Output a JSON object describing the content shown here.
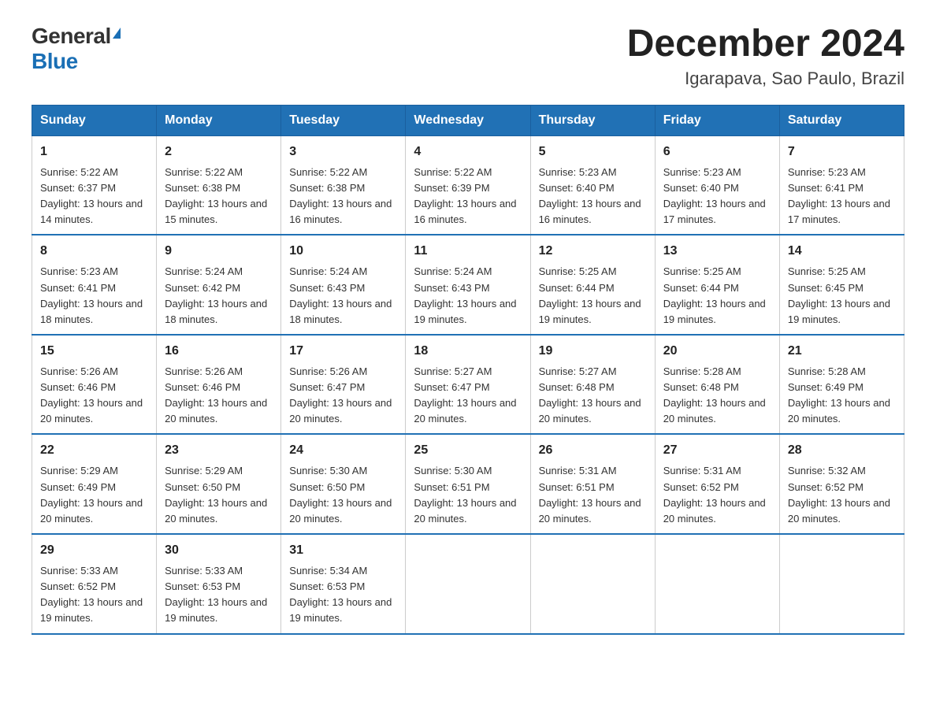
{
  "logo": {
    "general": "General",
    "blue": "Blue"
  },
  "title": "December 2024",
  "subtitle": "Igarapava, Sao Paulo, Brazil",
  "days_of_week": [
    "Sunday",
    "Monday",
    "Tuesday",
    "Wednesday",
    "Thursday",
    "Friday",
    "Saturday"
  ],
  "weeks": [
    [
      {
        "day": "1",
        "sunrise": "5:22 AM",
        "sunset": "6:37 PM",
        "daylight": "13 hours and 14 minutes."
      },
      {
        "day": "2",
        "sunrise": "5:22 AM",
        "sunset": "6:38 PM",
        "daylight": "13 hours and 15 minutes."
      },
      {
        "day": "3",
        "sunrise": "5:22 AM",
        "sunset": "6:38 PM",
        "daylight": "13 hours and 16 minutes."
      },
      {
        "day": "4",
        "sunrise": "5:22 AM",
        "sunset": "6:39 PM",
        "daylight": "13 hours and 16 minutes."
      },
      {
        "day": "5",
        "sunrise": "5:23 AM",
        "sunset": "6:40 PM",
        "daylight": "13 hours and 16 minutes."
      },
      {
        "day": "6",
        "sunrise": "5:23 AM",
        "sunset": "6:40 PM",
        "daylight": "13 hours and 17 minutes."
      },
      {
        "day": "7",
        "sunrise": "5:23 AM",
        "sunset": "6:41 PM",
        "daylight": "13 hours and 17 minutes."
      }
    ],
    [
      {
        "day": "8",
        "sunrise": "5:23 AM",
        "sunset": "6:41 PM",
        "daylight": "13 hours and 18 minutes."
      },
      {
        "day": "9",
        "sunrise": "5:24 AM",
        "sunset": "6:42 PM",
        "daylight": "13 hours and 18 minutes."
      },
      {
        "day": "10",
        "sunrise": "5:24 AM",
        "sunset": "6:43 PM",
        "daylight": "13 hours and 18 minutes."
      },
      {
        "day": "11",
        "sunrise": "5:24 AM",
        "sunset": "6:43 PM",
        "daylight": "13 hours and 19 minutes."
      },
      {
        "day": "12",
        "sunrise": "5:25 AM",
        "sunset": "6:44 PM",
        "daylight": "13 hours and 19 minutes."
      },
      {
        "day": "13",
        "sunrise": "5:25 AM",
        "sunset": "6:44 PM",
        "daylight": "13 hours and 19 minutes."
      },
      {
        "day": "14",
        "sunrise": "5:25 AM",
        "sunset": "6:45 PM",
        "daylight": "13 hours and 19 minutes."
      }
    ],
    [
      {
        "day": "15",
        "sunrise": "5:26 AM",
        "sunset": "6:46 PM",
        "daylight": "13 hours and 20 minutes."
      },
      {
        "day": "16",
        "sunrise": "5:26 AM",
        "sunset": "6:46 PM",
        "daylight": "13 hours and 20 minutes."
      },
      {
        "day": "17",
        "sunrise": "5:26 AM",
        "sunset": "6:47 PM",
        "daylight": "13 hours and 20 minutes."
      },
      {
        "day": "18",
        "sunrise": "5:27 AM",
        "sunset": "6:47 PM",
        "daylight": "13 hours and 20 minutes."
      },
      {
        "day": "19",
        "sunrise": "5:27 AM",
        "sunset": "6:48 PM",
        "daylight": "13 hours and 20 minutes."
      },
      {
        "day": "20",
        "sunrise": "5:28 AM",
        "sunset": "6:48 PM",
        "daylight": "13 hours and 20 minutes."
      },
      {
        "day": "21",
        "sunrise": "5:28 AM",
        "sunset": "6:49 PM",
        "daylight": "13 hours and 20 minutes."
      }
    ],
    [
      {
        "day": "22",
        "sunrise": "5:29 AM",
        "sunset": "6:49 PM",
        "daylight": "13 hours and 20 minutes."
      },
      {
        "day": "23",
        "sunrise": "5:29 AM",
        "sunset": "6:50 PM",
        "daylight": "13 hours and 20 minutes."
      },
      {
        "day": "24",
        "sunrise": "5:30 AM",
        "sunset": "6:50 PM",
        "daylight": "13 hours and 20 minutes."
      },
      {
        "day": "25",
        "sunrise": "5:30 AM",
        "sunset": "6:51 PM",
        "daylight": "13 hours and 20 minutes."
      },
      {
        "day": "26",
        "sunrise": "5:31 AM",
        "sunset": "6:51 PM",
        "daylight": "13 hours and 20 minutes."
      },
      {
        "day": "27",
        "sunrise": "5:31 AM",
        "sunset": "6:52 PM",
        "daylight": "13 hours and 20 minutes."
      },
      {
        "day": "28",
        "sunrise": "5:32 AM",
        "sunset": "6:52 PM",
        "daylight": "13 hours and 20 minutes."
      }
    ],
    [
      {
        "day": "29",
        "sunrise": "5:33 AM",
        "sunset": "6:52 PM",
        "daylight": "13 hours and 19 minutes."
      },
      {
        "day": "30",
        "sunrise": "5:33 AM",
        "sunset": "6:53 PM",
        "daylight": "13 hours and 19 minutes."
      },
      {
        "day": "31",
        "sunrise": "5:34 AM",
        "sunset": "6:53 PM",
        "daylight": "13 hours and 19 minutes."
      },
      null,
      null,
      null,
      null
    ]
  ]
}
